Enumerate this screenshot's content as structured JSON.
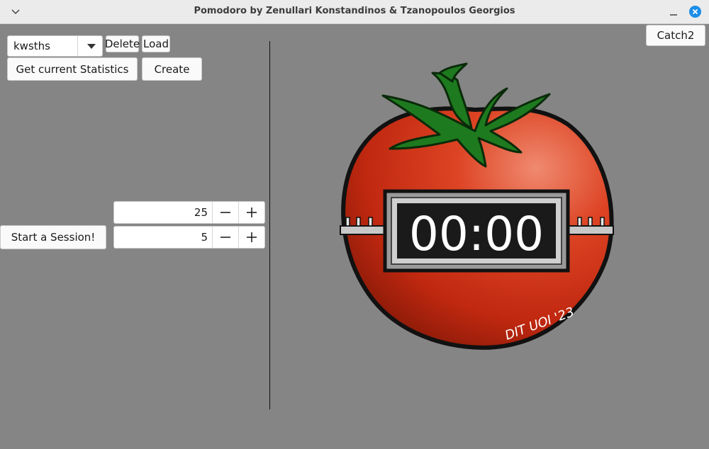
{
  "window": {
    "title": "Pomodoro by Zenullari Konstandinos & Tzanopoulos Georgios"
  },
  "profile": {
    "selected": "kwsths",
    "delete_label": "Delete",
    "load_label": "Load",
    "stats_label": "Get current Statistics",
    "create_label": "Create"
  },
  "session": {
    "start_label": "Start a Session!",
    "work_minutes": "25",
    "break_minutes": "5"
  },
  "catch_label": "Catch2",
  "timer": {
    "display": "00:00",
    "signature": "DIT UOI '23"
  },
  "colors": {
    "background": "#858585",
    "accent": "#1c8ee8",
    "tomato": "#d0301a",
    "leaves": "#1e7a1e"
  }
}
